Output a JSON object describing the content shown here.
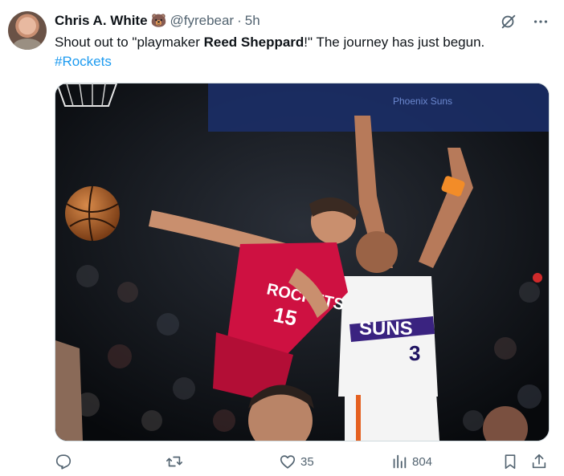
{
  "author": {
    "name": "Chris A. White",
    "badge_emoji": "🐻",
    "handle": "@fyrebear",
    "separator": "·",
    "time": "5h"
  },
  "tweet": {
    "text_before": "Shout out to \"playmaker ",
    "bold_name": "Reed Sheppard",
    "text_after": "!\" The journey has just begun.",
    "hashtag": "#Rockets"
  },
  "media": {
    "jersey_rockets_word": "ROCKETS",
    "jersey_rockets_number": "15",
    "jersey_suns_word": "SUNS",
    "jersey_suns_number": "3",
    "arena_banner": "Phoenix Suns"
  },
  "actions": {
    "reply_count": "",
    "repost_count": "",
    "like_count": "35",
    "views_count": "804"
  },
  "icons": {
    "grok": "grok-icon",
    "more": "more-icon",
    "reply": "reply-icon",
    "repost": "repost-icon",
    "like": "heart-icon",
    "views": "views-icon",
    "bookmark": "bookmark-icon",
    "share": "share-icon"
  },
  "colors": {
    "accent": "#1d9bf0",
    "muted": "#536471",
    "rockets_red": "#ce1141",
    "suns_purple": "#1d1160",
    "suns_orange": "#e56020"
  }
}
